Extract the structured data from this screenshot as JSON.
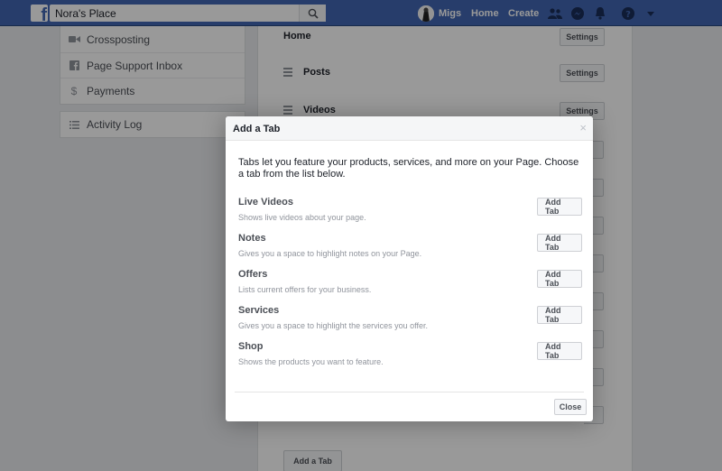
{
  "topbar": {
    "search_value": "Nora's Place",
    "user_name": "Migs",
    "nav_home": "Home",
    "nav_create": "Create"
  },
  "sidebar": {
    "group1": [
      {
        "label": "Crossposting",
        "icon": "video-camera-icon"
      },
      {
        "label": "Page Support Inbox",
        "icon": "facebook-square-icon"
      },
      {
        "label": "Payments",
        "icon": "dollar-icon"
      }
    ],
    "group2": [
      {
        "label": "Activity Log",
        "icon": "list-icon"
      }
    ]
  },
  "main": {
    "tabs": [
      {
        "label": "Home",
        "button": "Settings"
      },
      {
        "label": "Posts",
        "button": "Settings"
      },
      {
        "label": "Videos",
        "button": "Settings"
      }
    ],
    "add_tab_label": "Add a Tab"
  },
  "dialog": {
    "title": "Add a Tab",
    "close_symbol": "×",
    "intro": "Tabs let you feature your products, services, and more on your Page. Choose a tab from the list below.",
    "options": [
      {
        "title": "Live Videos",
        "description": "Shows live videos about your page.",
        "button": "Add Tab"
      },
      {
        "title": "Notes",
        "description": "Gives you a space to highlight notes on your Page.",
        "button": "Add Tab"
      },
      {
        "title": "Offers",
        "description": "Lists current offers for your business.",
        "button": "Add Tab"
      },
      {
        "title": "Services",
        "description": "Gives you a space to highlight the services you offer.",
        "button": "Add Tab"
      },
      {
        "title": "Shop",
        "description": "Shows the products you want to feature.",
        "button": "Add Tab"
      }
    ],
    "close_label": "Close"
  },
  "colors": {
    "brand_blue": "#4267b2",
    "page_bg": "#e9ebee"
  }
}
